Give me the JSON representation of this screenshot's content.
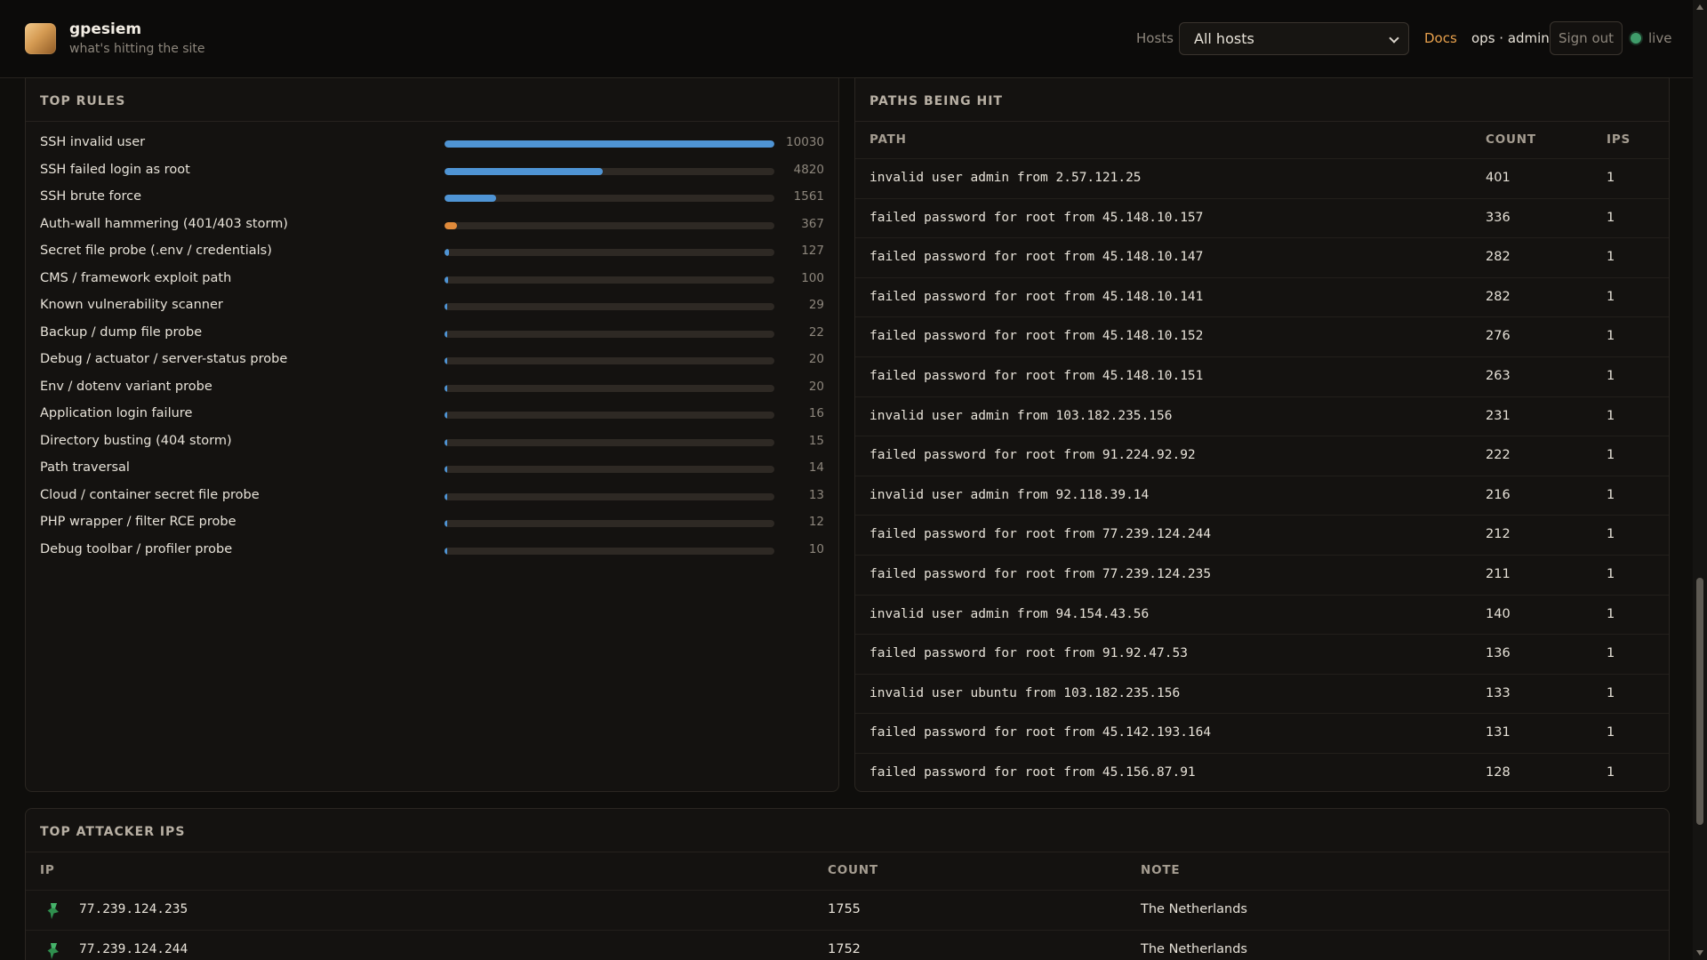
{
  "header": {
    "brand_name": "gpesiem",
    "brand_tagline": "what's hitting the site",
    "hosts_label": "Hosts",
    "host_selected": "All hosts",
    "docs_label": "Docs",
    "user_label": "ops · admin",
    "signout_label": "Sign out",
    "live_label": "live"
  },
  "rules": {
    "title": "TOP RULES",
    "max": 10030,
    "items": [
      {
        "label": "SSH invalid user",
        "count": 10030,
        "color": "#4f94d4"
      },
      {
        "label": "SSH failed login as root",
        "count": 4820,
        "color": "#4f94d4"
      },
      {
        "label": "SSH brute force",
        "count": 1561,
        "color": "#4f94d4"
      },
      {
        "label": "Auth-wall hammering (401/403 storm)",
        "count": 367,
        "color": "#e08a3a"
      },
      {
        "label": "Secret file probe (.env / credentials)",
        "count": 127,
        "color": "#4f94d4"
      },
      {
        "label": "CMS / framework exploit path",
        "count": 100,
        "color": "#4f94d4"
      },
      {
        "label": "Known vulnerability scanner",
        "count": 29,
        "color": "#4f94d4"
      },
      {
        "label": "Backup / dump file probe",
        "count": 22,
        "color": "#4f94d4"
      },
      {
        "label": "Debug / actuator / server-status probe",
        "count": 20,
        "color": "#4f94d4"
      },
      {
        "label": "Env / dotenv variant probe",
        "count": 20,
        "color": "#4f94d4"
      },
      {
        "label": "Application login failure",
        "count": 16,
        "color": "#4f94d4"
      },
      {
        "label": "Directory busting (404 storm)",
        "count": 15,
        "color": "#4f94d4"
      },
      {
        "label": "Path traversal",
        "count": 14,
        "color": "#4f94d4"
      },
      {
        "label": "Cloud / container secret file probe",
        "count": 13,
        "color": "#4f94d4"
      },
      {
        "label": "PHP wrapper / filter RCE probe",
        "count": 12,
        "color": "#4f94d4"
      },
      {
        "label": "Debug toolbar / profiler probe",
        "count": 10,
        "color": "#4f94d4"
      }
    ]
  },
  "paths": {
    "title": "PATHS BEING HIT",
    "col_path": "PATH",
    "col_count": "COUNT",
    "col_ips": "IPS",
    "rows": [
      {
        "path": "invalid user admin from 2.57.121.25",
        "count": "401",
        "ips": "1"
      },
      {
        "path": "failed password for root from 45.148.10.157",
        "count": "336",
        "ips": "1"
      },
      {
        "path": "failed password for root from 45.148.10.147",
        "count": "282",
        "ips": "1"
      },
      {
        "path": "failed password for root from 45.148.10.141",
        "count": "282",
        "ips": "1"
      },
      {
        "path": "failed password for root from 45.148.10.152",
        "count": "276",
        "ips": "1"
      },
      {
        "path": "failed password for root from 45.148.10.151",
        "count": "263",
        "ips": "1"
      },
      {
        "path": "invalid user admin from 103.182.235.156",
        "count": "231",
        "ips": "1"
      },
      {
        "path": "failed password for root from 91.224.92.92",
        "count": "222",
        "ips": "1"
      },
      {
        "path": "invalid user admin from 92.118.39.14",
        "count": "216",
        "ips": "1"
      },
      {
        "path": "failed password for root from 77.239.124.244",
        "count": "212",
        "ips": "1"
      },
      {
        "path": "failed password for root from 77.239.124.235",
        "count": "211",
        "ips": "1"
      },
      {
        "path": "invalid user admin from 94.154.43.56",
        "count": "140",
        "ips": "1"
      },
      {
        "path": "failed password for root from 91.92.47.53",
        "count": "136",
        "ips": "1"
      },
      {
        "path": "invalid user ubuntu from 103.182.235.156",
        "count": "133",
        "ips": "1"
      },
      {
        "path": "failed password for root from 45.142.193.164",
        "count": "131",
        "ips": "1"
      },
      {
        "path": "failed password for root from 45.156.87.91",
        "count": "128",
        "ips": "1"
      }
    ]
  },
  "attackers": {
    "title": "TOP ATTACKER IPS",
    "col_ip": "IP",
    "col_count": "COUNT",
    "col_note": "NOTE",
    "rows": [
      {
        "ip": "77.239.124.235",
        "count": "1755",
        "note": "The Netherlands",
        "icon": "pin-icon"
      },
      {
        "ip": "77.239.124.244",
        "count": "1752",
        "note": "The Netherlands",
        "icon": "pin-icon"
      }
    ]
  },
  "colors": {
    "accent_blue": "#4f94d4",
    "accent_orange": "#e08a3a",
    "live_green": "#3f9c6a",
    "docs_link": "#e7a04c"
  }
}
